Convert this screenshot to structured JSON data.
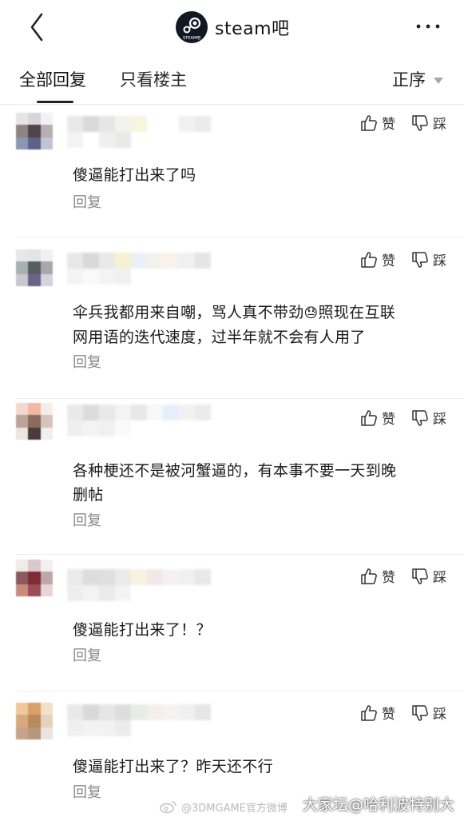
{
  "header": {
    "back_icon": "chevron-left-icon",
    "title": "steam吧",
    "logo_text": "STEAM吧",
    "more_icon": "more-dots-icon"
  },
  "tabs": {
    "all_replies": "全部回复",
    "op_only": "只看楼主",
    "sort_label": "正序"
  },
  "actions": {
    "like": "赞",
    "dislike": "踩"
  },
  "reply_label": "回复",
  "comments": [
    {
      "lines": [
        "傻逼能打出来了吗"
      ]
    },
    {
      "lines": [
        "伞兵我都用来自嘲，骂人真不带劲",
        "网用语的迭代速度，过半年就不会有人用了"
      ],
      "emoji": "😓",
      "line1_suffix": "照现在互联"
    },
    {
      "lines": [
        "各种梗还不是被河蟹逼的，有本事不要一天到晚",
        "删帖"
      ]
    },
    {
      "lines": [
        "傻逼能打出来了！？"
      ]
    },
    {
      "lines": [
        "傻逼能打出来了？昨天还不行"
      ]
    }
  ],
  "watermark": {
    "left": "@3DMGAME官方微博",
    "right": "大家坛@哈利波特别大"
  },
  "colors": {
    "text": "#1a1a1a",
    "muted": "#8a8a8a",
    "caret": "#a8a8a8"
  }
}
